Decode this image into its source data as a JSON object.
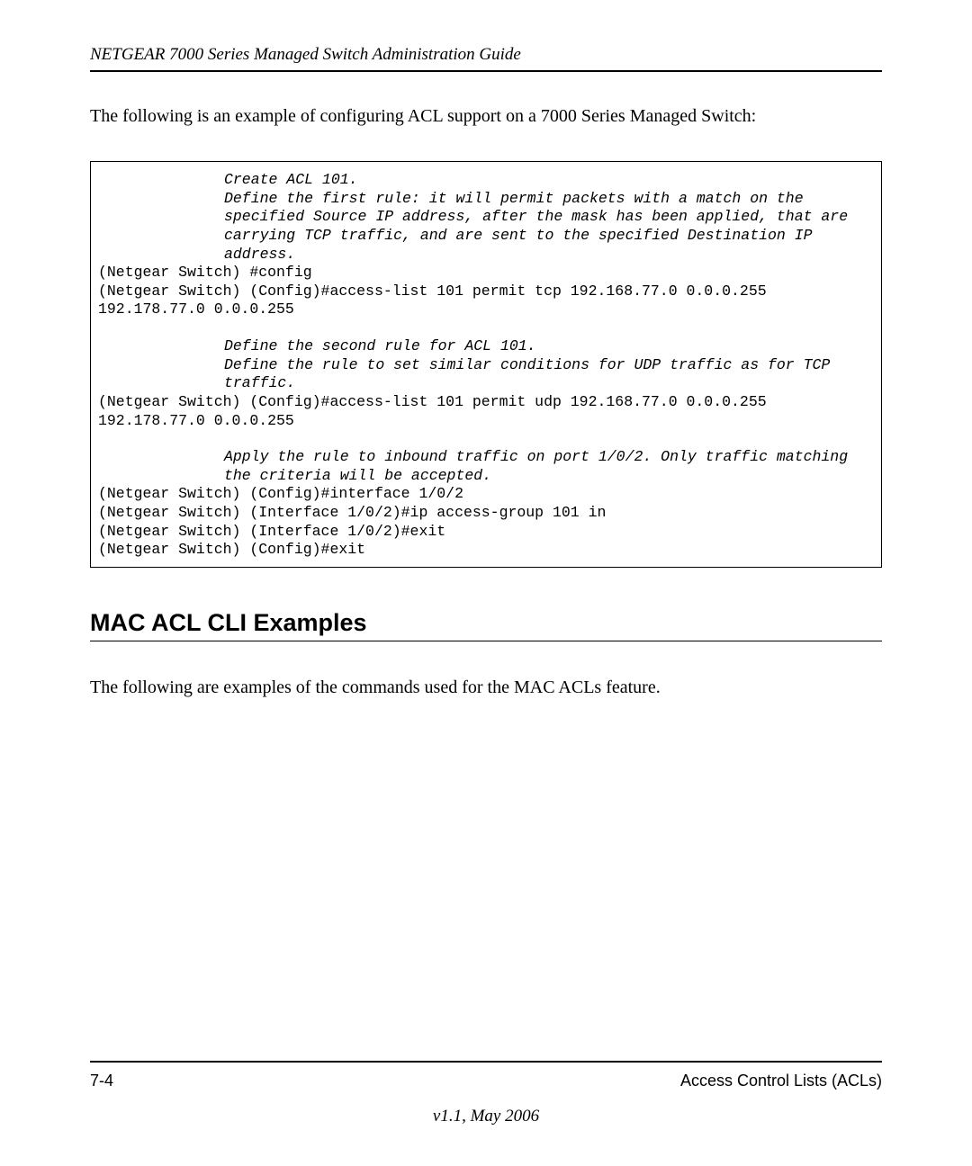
{
  "header": {
    "title": "NETGEAR 7000  Series Managed Switch Administration Guide"
  },
  "intro": "The following is an example of configuring ACL support on a 7000 Series Managed Switch:",
  "code": {
    "c1a": "Create ACL 101.",
    "c1b": "Define the first rule: it will permit packets with a match on the specified Source IP address, after the mask has been applied, that are carrying TCP traffic, and are sent to the specified Destination IP address.",
    "l1": "(Netgear Switch) #config",
    "l2": "(Netgear Switch) (Config)#access-list 101 permit tcp 192.168.77.0 0.0.0.255 192.178.77.0 0.0.0.255",
    "c2a": "Define the second rule for ACL 101.",
    "c2b": "Define the rule to set similar conditions for UDP traffic as for TCP traffic.",
    "l3": "(Netgear Switch) (Config)#access-list 101 permit udp 192.168.77.0 0.0.0.255 192.178.77.0 0.0.0.255",
    "c3": "Apply the rule to inbound traffic on port 1/0/2. Only traffic matching the criteria will be accepted.",
    "l4": "(Netgear Switch) (Config)#interface 1/0/2",
    "l5": "(Netgear Switch) (Interface 1/0/2)#ip access-group 101 in",
    "l6": "(Netgear Switch) (Interface 1/0/2)#exit",
    "l7": "(Netgear Switch) (Config)#exit"
  },
  "section": {
    "heading": "MAC ACL CLI Examples",
    "text": "The following are examples of the commands used for the MAC ACLs feature."
  },
  "footer": {
    "page": "7-4",
    "chapter": "Access Control Lists (ACLs)",
    "version": "v1.1, May 2006"
  }
}
